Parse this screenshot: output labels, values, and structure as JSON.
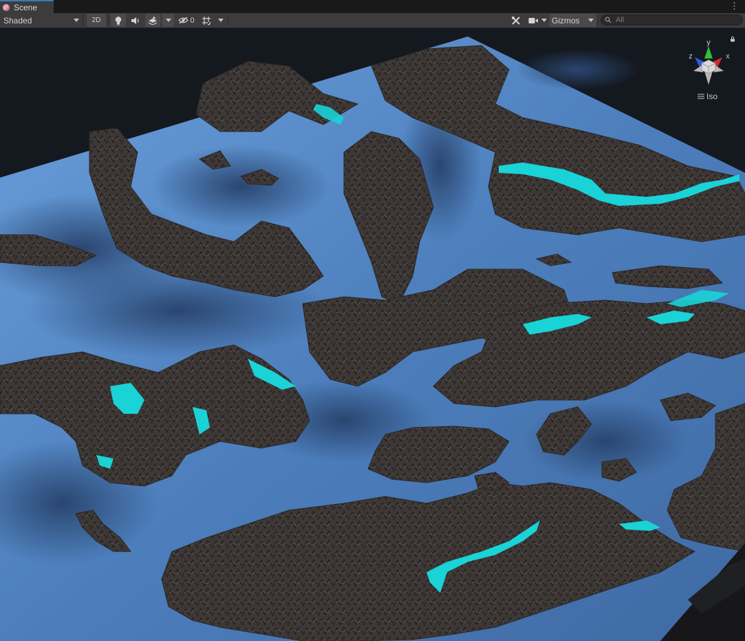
{
  "tab": {
    "title": "Scene"
  },
  "toolbar": {
    "shading_mode": "Shaded",
    "btn_2d": "2D",
    "hidden_count": "0",
    "gizmos_label": "Gizmos",
    "search_placeholder": "All"
  },
  "orientation": {
    "x_label": "x",
    "y_label": "y",
    "z_label": "z",
    "projection": "Iso"
  },
  "icons": [
    "scene-icon",
    "kebab-menu-icon",
    "lightbulb-icon",
    "audio-icon",
    "effects-icon",
    "visibility-icon",
    "grid-icon",
    "tools-icon",
    "camera-icon",
    "search-icon",
    "lock-icon",
    "hamburger-icon"
  ],
  "colors": {
    "water_light": "#5b8fcf",
    "water_dark": "#223a5c",
    "rock": "#3b3634",
    "cyan": "#19d3d6",
    "background": "#14181f"
  }
}
